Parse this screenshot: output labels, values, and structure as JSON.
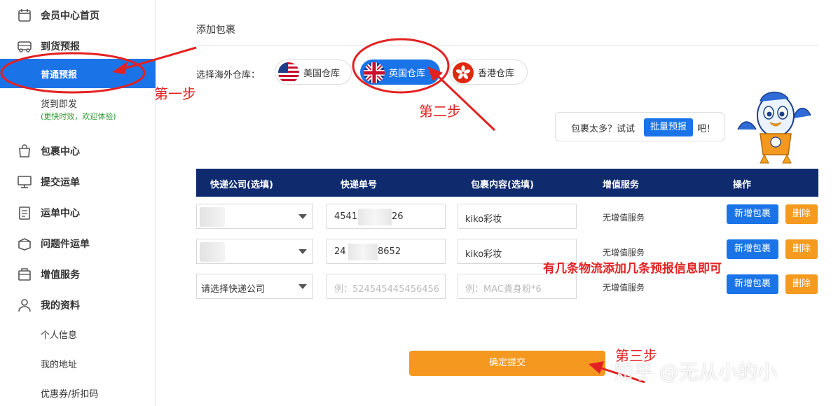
{
  "sidebar": {
    "items": [
      {
        "label": "会员中心首页",
        "icon": "calendar-icon"
      },
      {
        "label": "到货预报",
        "icon": "truck-icon"
      },
      {
        "label": "普通预报"
      },
      {
        "label": "货到即发"
      },
      {
        "label": "包裹中心",
        "icon": "bag-icon"
      },
      {
        "label": "提交运单",
        "icon": "monitor-icon"
      },
      {
        "label": "运单中心",
        "icon": "clipboard-icon"
      },
      {
        "label": "问题件运单",
        "icon": "box-icon"
      },
      {
        "label": "增值服务",
        "icon": "package-icon"
      },
      {
        "label": "我的资料",
        "icon": "user-icon"
      },
      {
        "label": "个人信息"
      },
      {
        "label": "我的地址"
      },
      {
        "label": "优惠券/折扣码"
      }
    ],
    "note": "(更快时效，欢迎体验)"
  },
  "main": {
    "section_title": "添加包裹",
    "warehouse_label": "选择海外仓库：",
    "warehouses": [
      "美国仓库",
      "英国仓库",
      "香港仓库"
    ],
    "selected_warehouse": "英国仓库",
    "bulk": {
      "prefix": "包裹太多？试试",
      "button": "批量预报",
      "suffix": "吧！"
    },
    "table": {
      "headers": [
        "快递公司(选填)",
        "快递单号",
        "包裹内容(选填)",
        "增值服务",
        "操作"
      ],
      "rows": [
        {
          "company": "",
          "tracking": "4541",
          "tracking_tail": "26",
          "content": "kiko彩妆",
          "service": "无增值服务"
        },
        {
          "company": "",
          "tracking": "24",
          "tracking_tail": "8652",
          "content": "kiko彩妆",
          "service": "无增值服务"
        },
        {
          "company": "请选择快递公司",
          "tracking_placeholder": "例：524545445456456",
          "content_placeholder": "例：MAC粪身粉*6",
          "service": "无增值服务"
        }
      ],
      "add_label": "新增包裹",
      "delete_label": "删除"
    },
    "submit_label": "确定提交"
  },
  "annotations": {
    "step1": "第一步",
    "step2": "第二步",
    "step3": "第三步",
    "note": "有几条物流添加几条预报信息即可",
    "watermark": "知乎 @无从小的小"
  },
  "colors": {
    "primary": "#1a74e8",
    "header": "#0f2b6e",
    "orange": "#f4981f",
    "annotation": "#e32121"
  }
}
